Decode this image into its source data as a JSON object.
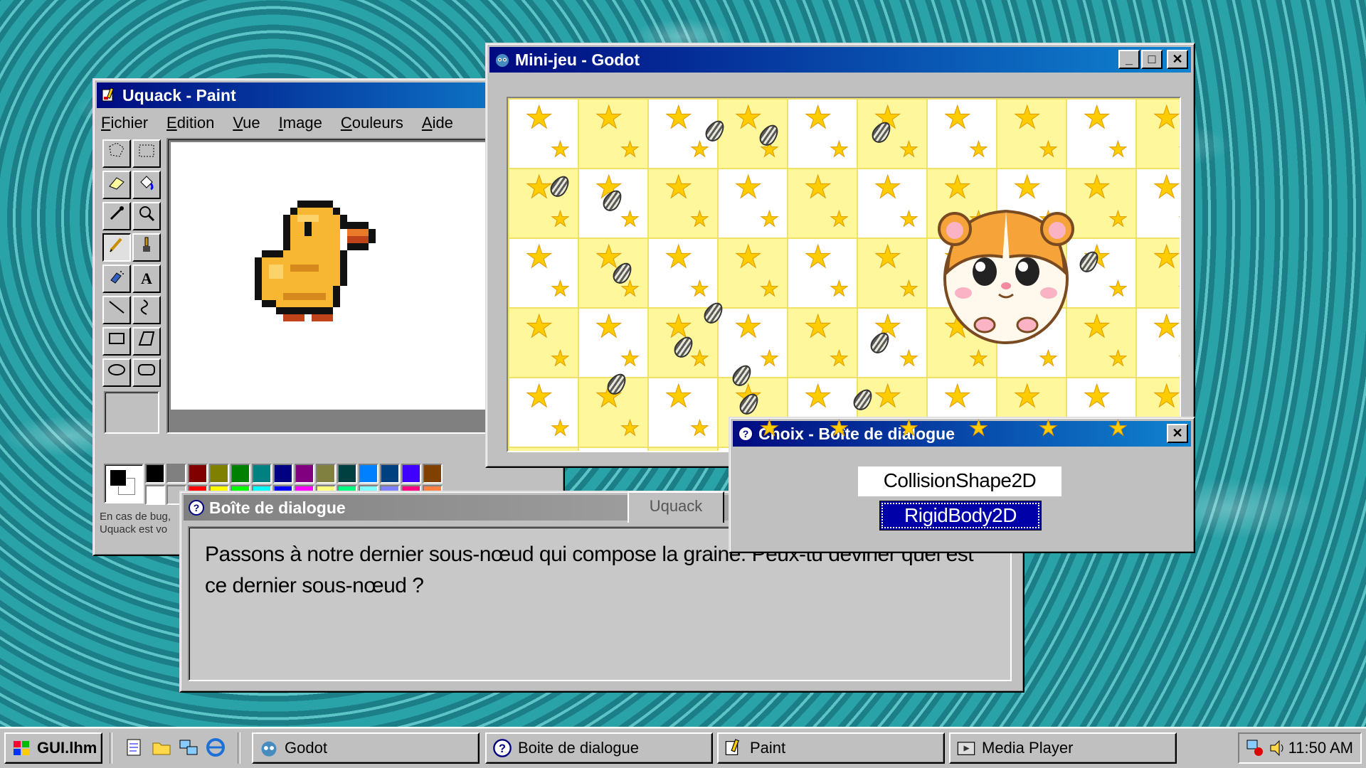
{
  "desktop": {
    "background": "water"
  },
  "paint": {
    "title": "Uquack - Paint",
    "menu": [
      "Fichier",
      "Edition",
      "Vue",
      "Image",
      "Couleurs",
      "Aide"
    ],
    "tools": [
      "free-select-icon",
      "rect-select-icon",
      "eraser-icon",
      "fill-icon",
      "picker-icon",
      "magnifier-icon",
      "pencil-icon",
      "brush-icon",
      "airbrush-icon",
      "text-icon",
      "line-icon",
      "curve-icon",
      "rectangle-icon",
      "polygon-icon",
      "ellipse-icon",
      "rounded-rect-icon"
    ],
    "text_tool_glyph": "A",
    "palette_top": [
      "#000000",
      "#808080",
      "#800000",
      "#808000",
      "#008000",
      "#008080",
      "#000080",
      "#800080",
      "#808040",
      "#004040",
      "#0080ff",
      "#004080",
      "#4000ff",
      "#804000"
    ],
    "palette_bottom": [
      "#ffffff",
      "#c0c0c0",
      "#ff0000",
      "#ffff00",
      "#00ff00",
      "#00ffff",
      "#0000ff",
      "#ff00ff",
      "#ffff80",
      "#00ff80",
      "#80ffff",
      "#8080ff",
      "#ff0080",
      "#ff8040"
    ],
    "status_line1": "En cas de bug,",
    "status_line2": "Uquack  est vo"
  },
  "godot": {
    "title": "Mini-jeu - Godot",
    "buttons": [
      "_",
      "□",
      "✕"
    ]
  },
  "dialog": {
    "title": "Boîte de dialogue",
    "tab": "Uquack",
    "message": "Passons à notre dernier sous-nœud qui compose la graine. Peux-tu deviner quel est ce dernier sous-nœud ?"
  },
  "choix": {
    "title": "Choix - Boîte de dialogue",
    "options": [
      "CollisionShape2D",
      "RigidBody2D"
    ],
    "selected": "RigidBody2D"
  },
  "taskbar": {
    "start_label": "GUI.lhm",
    "tasks": [
      "Godot",
      "Boite de dialogue",
      "Paint",
      "Media Player"
    ],
    "clock": "11:50 AM",
    "quick_launch": [
      "notepad-icon",
      "folder-icon",
      "network-icon",
      "ie-icon"
    ]
  },
  "colors": {
    "title_active_start": "#000a80",
    "title_active_end": "#1084d0",
    "selection": "#0000a8",
    "face": "#c0c0c0"
  }
}
